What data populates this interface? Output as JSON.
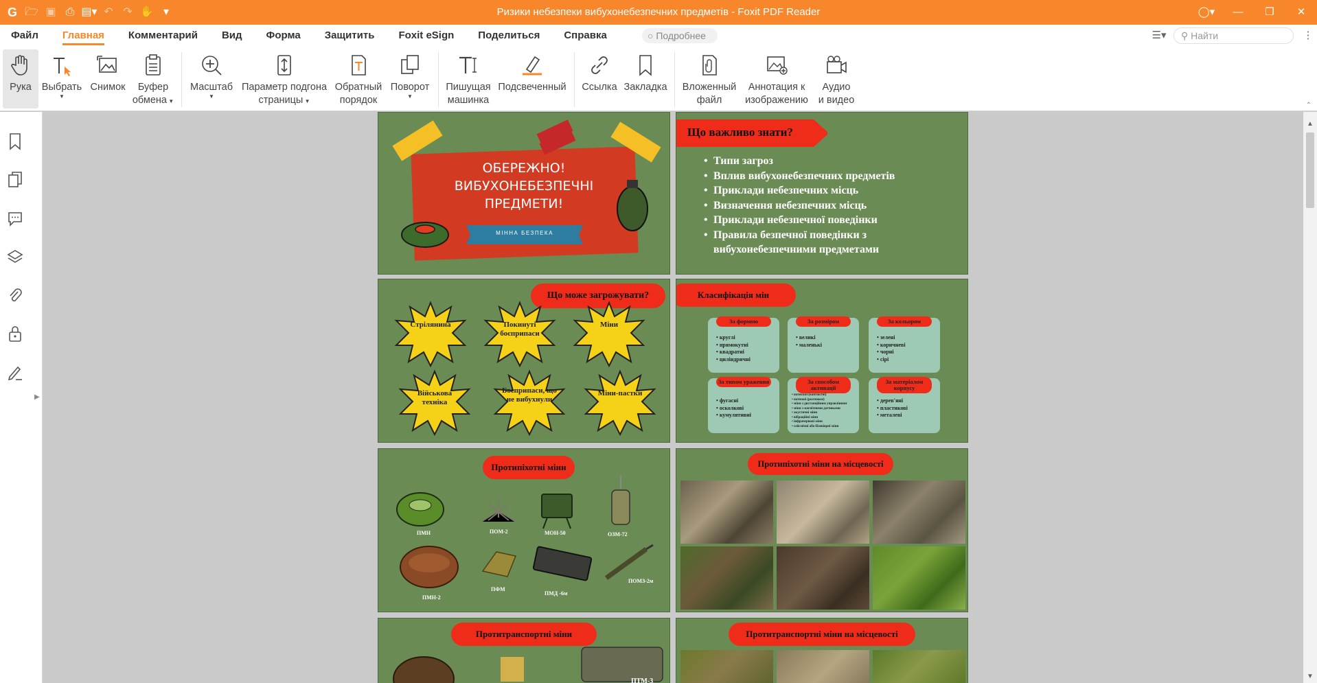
{
  "titlebar": {
    "title": "Ризики небезпеки вибухонебезпечних предметів - Foxit PDF Reader",
    "quick_access": [
      "foxit-logo-icon",
      "open-icon",
      "save-icon",
      "print-icon",
      "create-icon",
      "undo-icon",
      "redo-icon",
      "hand-tool-icon",
      "customize-icon"
    ],
    "window_controls": [
      "account-icon",
      "minimize-icon",
      "restore-icon",
      "close-icon"
    ]
  },
  "menu": {
    "tabs": [
      "Файл",
      "Главная",
      "Комментарий",
      "Вид",
      "Форма",
      "Защитить",
      "Foxit eSign",
      "Поделиться",
      "Справка"
    ],
    "active_tab": "Главная",
    "more_label": "Подробнее",
    "search_placeholder": "Найти"
  },
  "ribbon": {
    "hand": "Рука",
    "select": "Выбрать",
    "snapshot": "Снимок",
    "clipboard_1": "Буфер",
    "clipboard_2": "обмена",
    "zoom": "Масштаб",
    "fit_1": "Параметр подгона",
    "fit_2": "страницы",
    "reverse_1": "Обратный",
    "reverse_2": "порядок",
    "rotate": "Поворот",
    "typewriter_1": "Пишущая",
    "typewriter_2": "машинка",
    "highlight": "Подсвеченный",
    "link": "Ссылка",
    "bookmark": "Закладка",
    "attach_1": "Вложенный",
    "attach_2": "файл",
    "image_1": "Аннотация к",
    "image_2": "изображению",
    "av_1": "Аудио",
    "av_2": "и видео"
  },
  "pages": {
    "p1": {
      "line1": "ОБЕРЕЖНО!",
      "line2": "ВИБУХОНЕБЕЗПЕЧНІ",
      "line3": "ПРЕДМЕТИ!",
      "ribbon": "МІННА БЕЗПЕКА"
    },
    "p2": {
      "title": "Що важливо знати?",
      "items": [
        "Типи загроз",
        "Вплив вибухонебезпечних предметів",
        "Приклади небезпечних місць",
        "Визначення небезпечних місць",
        "Приклади небезпечної поведінки",
        "Правила безпечної поведінки з вибухонебезпечними предметами"
      ]
    },
    "p3": {
      "title": "Що може загрожувати?",
      "threats": [
        "Стрілянина",
        "Покинуті боєприпаси",
        "Міни",
        "Військова техніка",
        "Боєприпаси, що не вибухнули",
        "Міни-пастки"
      ]
    },
    "p4": {
      "title": "Класифікація мін",
      "cards": [
        {
          "title": "За формою",
          "items": [
            "круглі",
            "прямокутні",
            "квадратні",
            "циліндричні"
          ]
        },
        {
          "title": "За розміром",
          "items": [
            "великі",
            "маленькі"
          ]
        },
        {
          "title": "За кольором",
          "items": [
            "зелені",
            "коричневі",
            "чорні",
            "сірі"
          ]
        },
        {
          "title": "За типом ураження",
          "items": [
            "фугасні",
            "осколкові",
            "кумулятивні"
          ]
        },
        {
          "title": "За способом активації",
          "items": [
            "натискні (контактні)",
            "натяжні (розтяжки)",
            "міни з дистанційним управлінням",
            "міни з магнітними датчиками",
            "акустичні міни",
            "вібраційні міни",
            "інфрачервоні міни",
            "сейсмічні або біхевіорні міни"
          ]
        },
        {
          "title": "За матеріалом корпусу",
          "items": [
            "дерев'яні",
            "пластикові",
            "металеві"
          ]
        }
      ]
    },
    "p5": {
      "title": "Протипіхотні міни",
      "mines": [
        "ПМН",
        "ПОМ-2",
        "МОН-50",
        "ОЗМ-72",
        "ПМН-2",
        "ПФМ",
        "ПМД -6м",
        "ПОМЗ-2м"
      ]
    },
    "p6": {
      "title": "Протипіхотні міни на місцевості"
    },
    "p7": {
      "title": "Протитранспортні міни",
      "mine_label": "ПТМ-3"
    },
    "p8": {
      "title": "Протитранспортні міни на місцевості"
    }
  },
  "colors": {
    "accent": "#f7872a",
    "slide_green": "#6b8b55",
    "slide_red": "#ef2c1a",
    "burst_yellow": "#f5d117",
    "card_teal": "#9ec9b5"
  }
}
